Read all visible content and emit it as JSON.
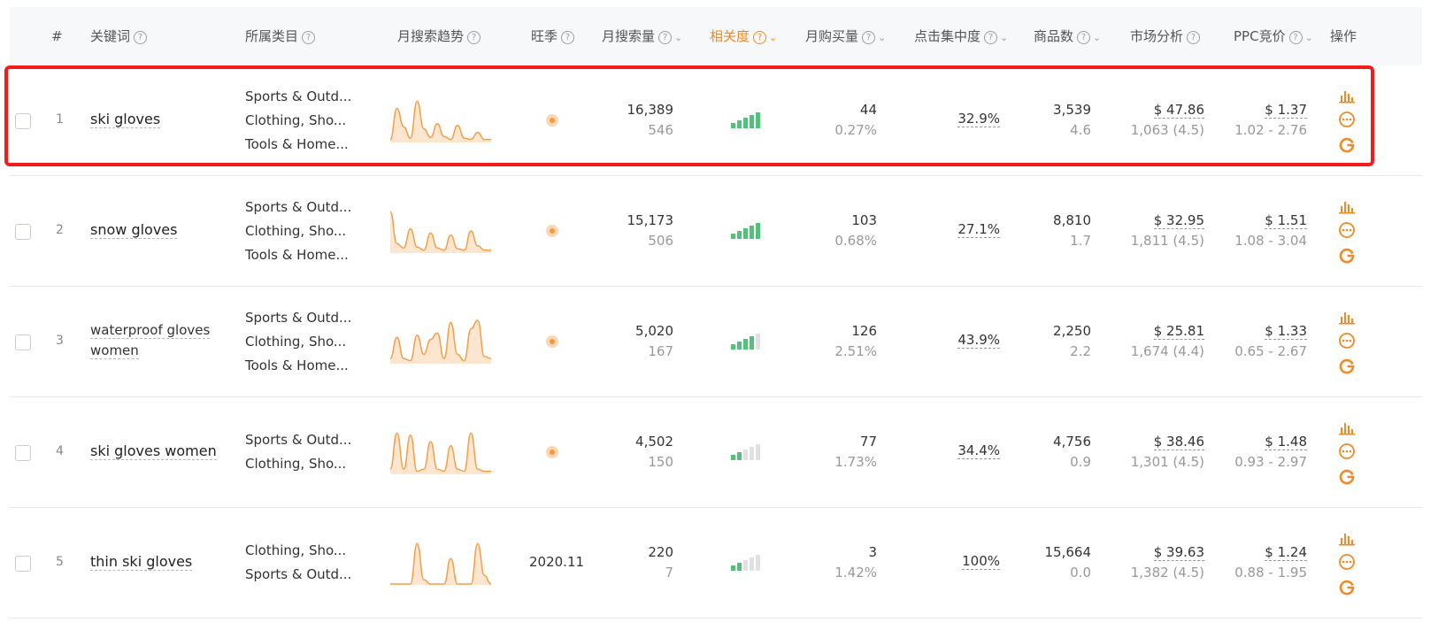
{
  "header": {
    "index": "#",
    "keyword": "关键词",
    "category": "所属类目",
    "trend": "月搜索趋势",
    "season": "旺季",
    "search_volume": "月搜索量",
    "relevance": "相关度",
    "purchases": "月购买量",
    "click_concentration": "点击集中度",
    "products": "商品数",
    "market": "市场分析",
    "ppc": "PPC竞价",
    "actions": "操作"
  },
  "accent_color": "#f08a24",
  "highlight_color": "#f21c1c",
  "rows": [
    {
      "index": "1",
      "keyword": "ski gloves",
      "categories": [
        "Sports & Outd...",
        "Clothing, Sho...",
        "Tools & Home..."
      ],
      "trend": [
        0.05,
        0.78,
        0.35,
        0.08,
        0.95,
        0.3,
        0.1,
        0.42,
        0.12,
        0.05,
        0.38,
        0.08,
        0.05,
        0.22,
        0.05,
        0.05
      ],
      "season_dot": true,
      "season_text": "",
      "search_volume": "16,389",
      "search_sub": "546",
      "relevance_level": 5,
      "purchases": "44",
      "purchases_sub": "0.27%",
      "click": "32.9%",
      "products": "3,539",
      "products_sub": "4.6",
      "market_price": "$ 47.86",
      "market_sub": "1,063 (4.5)",
      "ppc_price": "$ 1.37",
      "ppc_range": "1.02 - 2.76"
    },
    {
      "index": "2",
      "keyword": "snow gloves",
      "categories": [
        "Sports & Outd...",
        "Clothing, Sho...",
        "Tools & Home..."
      ],
      "trend": [
        0.95,
        0.2,
        0.1,
        0.55,
        0.12,
        0.05,
        0.45,
        0.1,
        0.05,
        0.4,
        0.08,
        0.05,
        0.5,
        0.15,
        0.05,
        0.05
      ],
      "season_dot": true,
      "season_text": "",
      "search_volume": "15,173",
      "search_sub": "506",
      "relevance_level": 5,
      "purchases": "103",
      "purchases_sub": "0.68%",
      "click": "27.1%",
      "products": "8,810",
      "products_sub": "1.7",
      "market_price": "$ 32.95",
      "market_sub": "1,811 (4.5)",
      "ppc_price": "$ 1.51",
      "ppc_range": "1.08 - 3.04"
    },
    {
      "index": "3",
      "keyword": "waterproof gloves women",
      "categories": [
        "Sports & Outd...",
        "Clothing, Sho...",
        "Tools & Home..."
      ],
      "trend": [
        0.1,
        0.6,
        0.1,
        0.05,
        0.65,
        0.2,
        0.55,
        0.7,
        0.1,
        0.95,
        0.2,
        0.05,
        0.8,
        1.0,
        0.15,
        0.1
      ],
      "season_dot": true,
      "season_text": "",
      "search_volume": "5,020",
      "search_sub": "167",
      "relevance_level": 4,
      "purchases": "126",
      "purchases_sub": "2.51%",
      "click": "43.9%",
      "products": "2,250",
      "products_sub": "2.2",
      "market_price": "$ 25.81",
      "market_sub": "1,674 (4.4)",
      "ppc_price": "$ 1.33",
      "ppc_range": "0.65 - 2.67"
    },
    {
      "index": "4",
      "keyword": "ski gloves women",
      "categories": [
        "Sports & Outd...",
        "Clothing, Sho..."
      ],
      "trend": [
        0.1,
        0.95,
        0.1,
        0.9,
        0.05,
        0.1,
        0.75,
        0.1,
        0.05,
        0.65,
        0.1,
        0.05,
        0.95,
        0.1,
        0.05,
        0.05
      ],
      "season_dot": true,
      "season_text": "",
      "search_volume": "4,502",
      "search_sub": "150",
      "relevance_level": 2,
      "purchases": "77",
      "purchases_sub": "1.73%",
      "click": "34.4%",
      "products": "4,756",
      "products_sub": "0.9",
      "market_price": "$ 38.46",
      "market_sub": "1,301 (4.5)",
      "ppc_price": "$ 1.48",
      "ppc_range": "0.93 - 2.97"
    },
    {
      "index": "5",
      "keyword": "thin ski gloves",
      "categories": [
        "Clothing, Sho...",
        "Sports & Outd..."
      ],
      "trend": [
        0.0,
        0.0,
        0.0,
        0.0,
        0.95,
        0.1,
        0.0,
        0.0,
        0.0,
        0.6,
        0.0,
        0.0,
        0.0,
        0.95,
        0.2,
        0.0
      ],
      "season_dot": false,
      "season_text": "2020.11",
      "search_volume": "220",
      "search_sub": "7",
      "relevance_level": 2,
      "purchases": "3",
      "purchases_sub": "1.42%",
      "click": "100%",
      "products": "15,664",
      "products_sub": "0.0",
      "market_price": "$ 39.63",
      "market_sub": "1,382 (4.5)",
      "ppc_price": "$ 1.24",
      "ppc_range": "0.88 - 1.95"
    }
  ],
  "row_action_icons": [
    "bar-chart-icon",
    "more-icon",
    "google-icon"
  ]
}
